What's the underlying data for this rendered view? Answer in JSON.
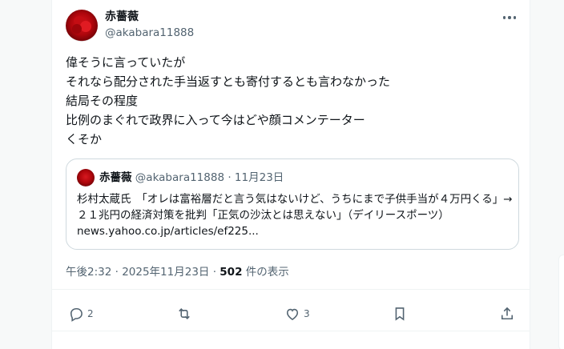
{
  "author": {
    "display_name": "赤薔薇",
    "handle": "@akabara11888"
  },
  "post": {
    "text": "偉そうに言っていたが\nそれなら配分された手当返すとも寄付するとも言わなかった\n結局その程度\n比例のまぐれで政界に入って今はどや顔コメンテーター\nくそか"
  },
  "quote": {
    "display_name": "赤薔薇",
    "handle": "@akabara11888",
    "date": " · 11月23日",
    "text": "杉村太蔵氏　「オレは富裕層だと言う気はないけど、うちにまで子供手当が４万円くる」→２１兆円の経済対策を批判「正気の沙汰とは思えない」（デイリースポーツ） news.yahoo.co.jp/articles/ef225..."
  },
  "meta": {
    "time": "午後2:32 · 2025年11月23日 · ",
    "views": "502",
    "views_label": " 件の表示"
  },
  "actions": {
    "replies": "2",
    "likes": "3"
  },
  "icons": [
    "more-icon",
    "reply-icon",
    "repost-icon",
    "like-icon",
    "bookmark-icon",
    "share-icon"
  ]
}
